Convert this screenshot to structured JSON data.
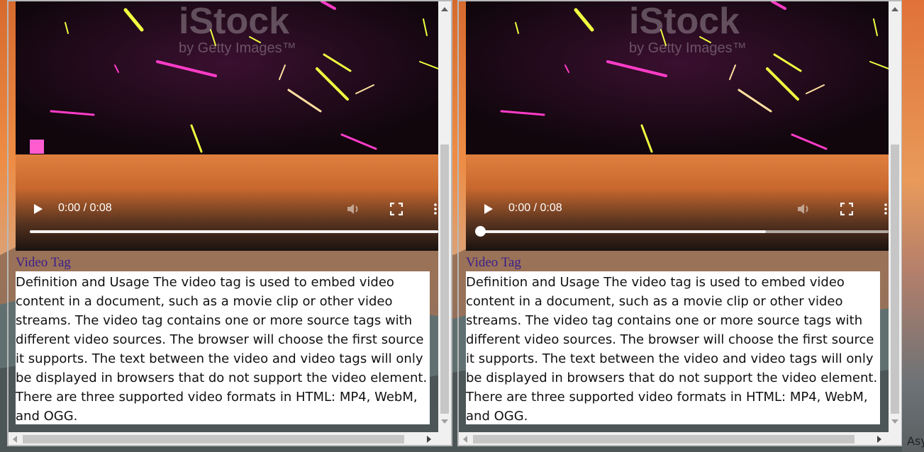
{
  "panes": [
    {
      "video": {
        "time": "0:00 / 0:08",
        "watermark_brand": "iStock",
        "watermark_sub": "by Getty Images",
        "progress": 0.0,
        "buffered": 1.0,
        "show_knob": false
      },
      "title": "Video Tag",
      "description": "Definition and Usage The video tag is used to embed video content in a document, such as a movie clip or other video streams. The video tag contains one or more source tags with different video sources. The browser will choose the first source it supports. The text between the video and video tags will only be displayed in browsers that do not support the video element. There are three supported video formats in HTML: MP4, WebM, and OGG."
    },
    {
      "video": {
        "time": "0:00 / 0:08",
        "watermark_brand": "iStock",
        "watermark_sub": "by Getty Images",
        "progress": 0.0,
        "buffered": 0.7,
        "show_knob": true
      },
      "title": "Video Tag",
      "description": "Definition and Usage The video tag is used to embed video content in a document, such as a movie clip or other video streams. The video tag contains one or more source tags with different video sources. The browser will choose the first source it supports. The text between the video and video tags will only be displayed in browsers that do not support the video element. There are three supported video formats in HTML: MP4, WebM, and OGG."
    }
  ],
  "edge_text": "Asy",
  "colors": {
    "title": "#3b1e8c",
    "neon_pink": "#ff3cc8",
    "neon_yellow": "#f0ff40",
    "sunset_orange": "#e0803f"
  }
}
